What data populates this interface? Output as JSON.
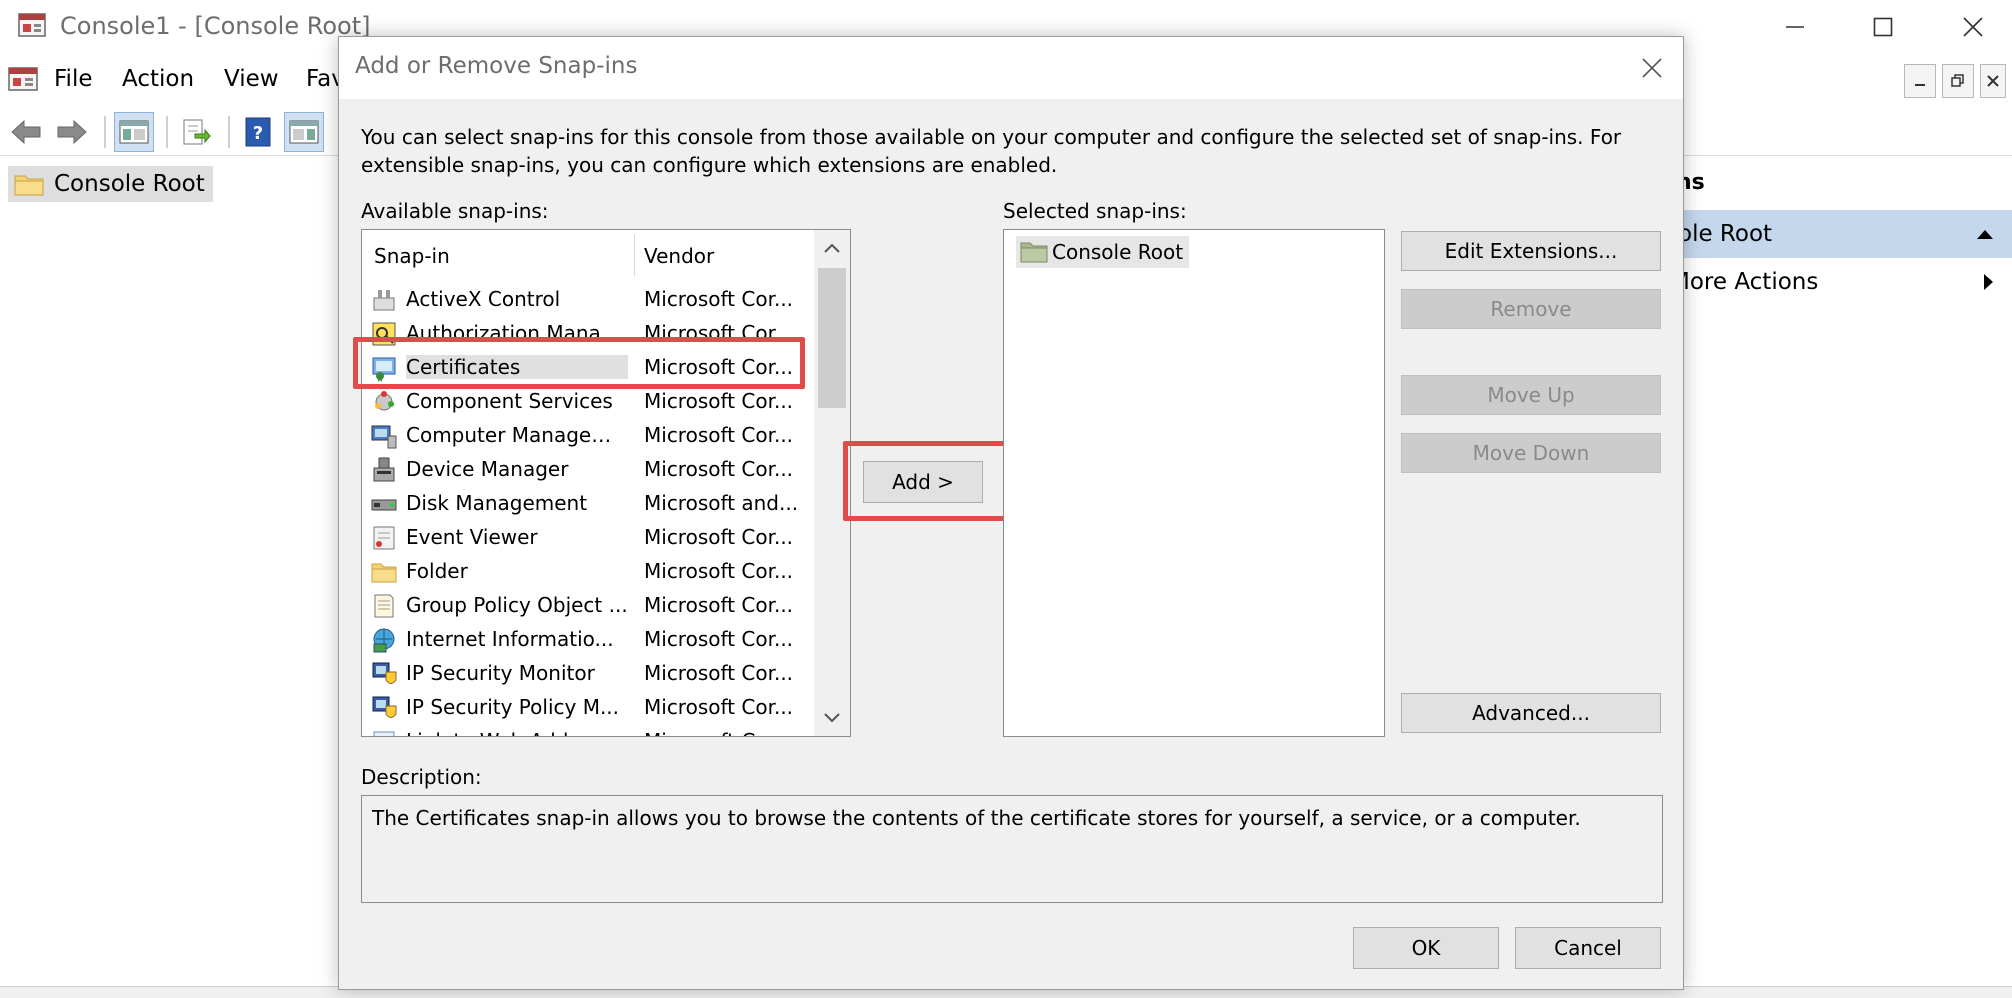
{
  "window": {
    "title": "Console1 - [Console Root]"
  },
  "menu": [
    "File",
    "Action",
    "View",
    "Fav"
  ],
  "tree": {
    "root_label": "Console Root"
  },
  "actions_pane": {
    "header_fragment": "ns",
    "selected_item": "ole Root",
    "more_actions": "More Actions"
  },
  "dialog": {
    "title": "Add or Remove Snap-ins",
    "intro": "You can select snap-ins for this console from those available on your computer and configure the selected set of snap-ins. For extensible snap-ins, you can configure which extensions are enabled.",
    "available_label": "Available snap-ins:",
    "columns": [
      "Snap-in",
      "Vendor"
    ],
    "snapins": [
      {
        "name": "ActiveX Control",
        "vendor": "Microsoft Cor...",
        "icon": "activex-control-icon"
      },
      {
        "name": "Authorization Manager",
        "vendor": "Microsoft Cor...",
        "icon": "authorization-manager-icon"
      },
      {
        "name": "Certificates",
        "vendor": "Microsoft Cor...",
        "icon": "certificates-icon",
        "selected": true
      },
      {
        "name": "Component Services",
        "vendor": "Microsoft Cor...",
        "icon": "component-services-icon"
      },
      {
        "name": "Computer Managem...",
        "vendor": "Microsoft Cor...",
        "icon": "computer-management-icon"
      },
      {
        "name": "Device Manager",
        "vendor": "Microsoft Cor...",
        "icon": "device-manager-icon"
      },
      {
        "name": "Disk Management",
        "vendor": "Microsoft and...",
        "icon": "disk-management-icon"
      },
      {
        "name": "Event Viewer",
        "vendor": "Microsoft Cor...",
        "icon": "event-viewer-icon"
      },
      {
        "name": "Folder",
        "vendor": "Microsoft Cor...",
        "icon": "folder-icon"
      },
      {
        "name": "Group Policy Object ...",
        "vendor": "Microsoft Cor...",
        "icon": "group-policy-icon"
      },
      {
        "name": "Internet Informatio...",
        "vendor": "Microsoft Cor...",
        "icon": "iis-icon"
      },
      {
        "name": "IP Security Monitor",
        "vendor": "Microsoft Cor...",
        "icon": "ip-security-monitor-icon"
      },
      {
        "name": "IP Security Policy M...",
        "vendor": "Microsoft Cor...",
        "icon": "ip-security-policy-icon"
      },
      {
        "name": "Link to Web Address",
        "vendor": "Microsoft Cor...",
        "icon": "link-icon"
      }
    ],
    "add_button": "Add >",
    "selected_label": "Selected snap-ins:",
    "selected_root": "Console Root",
    "buttons": {
      "edit_extensions": "Edit Extensions...",
      "remove": "Remove",
      "move_up": "Move Up",
      "move_down": "Move Down",
      "advanced": "Advanced..."
    },
    "description_label": "Description:",
    "description": "The Certificates snap-in allows you to browse the contents of the certificate stores for yourself, a service, or a computer.",
    "ok": "OK",
    "cancel": "Cancel"
  },
  "colors": {
    "highlight": "#e04b4b",
    "dialog_bg": "#f0f0f0",
    "selection_bg": "#c5d7ec"
  }
}
